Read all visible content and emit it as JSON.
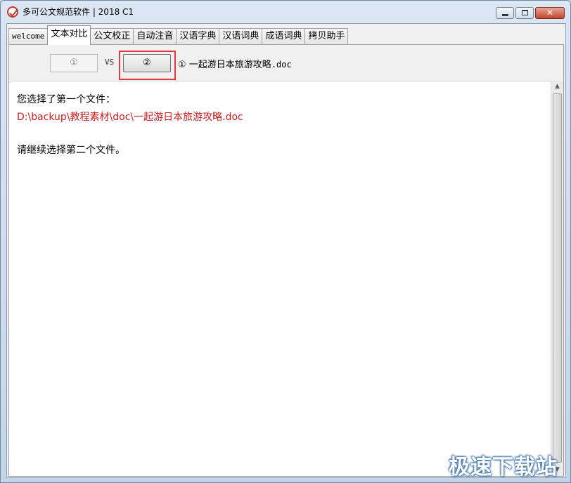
{
  "window": {
    "title": "多可公文规范软件 | 2018 C1",
    "controls": {
      "close_symbol": "✕"
    }
  },
  "tabs": [
    {
      "label": "welcome",
      "active": false
    },
    {
      "label": "文本对比",
      "active": true
    },
    {
      "label": "公文校正",
      "active": false
    },
    {
      "label": "自动注音",
      "active": false
    },
    {
      "label": "汉语字典",
      "active": false
    },
    {
      "label": "汉语词典",
      "active": false
    },
    {
      "label": "成语词典",
      "active": false
    },
    {
      "label": "拷贝助手",
      "active": false
    }
  ],
  "compare": {
    "first_button": "①",
    "vs_label": "VS",
    "second_button": "②",
    "file_marker": "①",
    "file_name": "一起游日本旅游攻略",
    "file_ext": ".doc"
  },
  "messages": {
    "first_selected": "您选择了第一个文件：",
    "first_path": "D:\\backup\\教程素材\\doc\\一起游日本旅游攻略.doc",
    "prompt_second": "请继续选择第二个文件。"
  },
  "scrollbar": {
    "up_arrow": "▲",
    "down_arrow": "▼"
  },
  "watermark": "极速下载站",
  "colors": {
    "highlight": "#e03c3c",
    "path_text": "#c81e1e",
    "title_bar": "#dbe6f3"
  }
}
